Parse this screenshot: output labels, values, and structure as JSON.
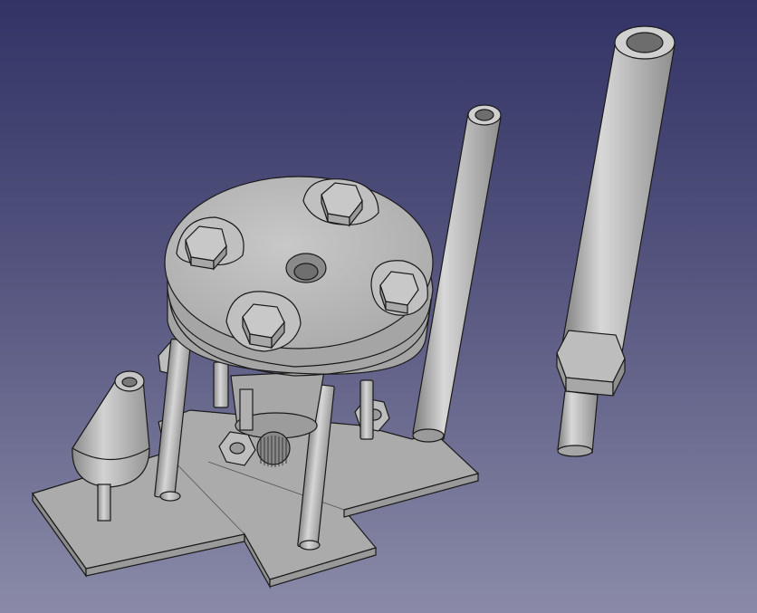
{
  "app": {
    "view": "3d-viewport",
    "background": {
      "top": "#333366",
      "bottom": "#8a8aa8"
    }
  },
  "model": {
    "parts": [
      {
        "name": "base-plate",
        "color": "#a9a9a9"
      },
      {
        "name": "support-rods",
        "color": "#b3b3b3"
      },
      {
        "name": "clamp-disc",
        "color": "#b5b5b5"
      },
      {
        "name": "hex-bolts",
        "color": "#c2c2c2"
      },
      {
        "name": "hex-nuts",
        "color": "#bdbdbd"
      },
      {
        "name": "motor-body",
        "color": "#a7a7a7"
      },
      {
        "name": "cone-part",
        "color": "#bbbbbb"
      },
      {
        "name": "thin-tube",
        "color": "#b8b8b8"
      },
      {
        "name": "large-tube",
        "color": "#b6b6b6"
      }
    ],
    "edge_color": "#1a1a1a"
  }
}
